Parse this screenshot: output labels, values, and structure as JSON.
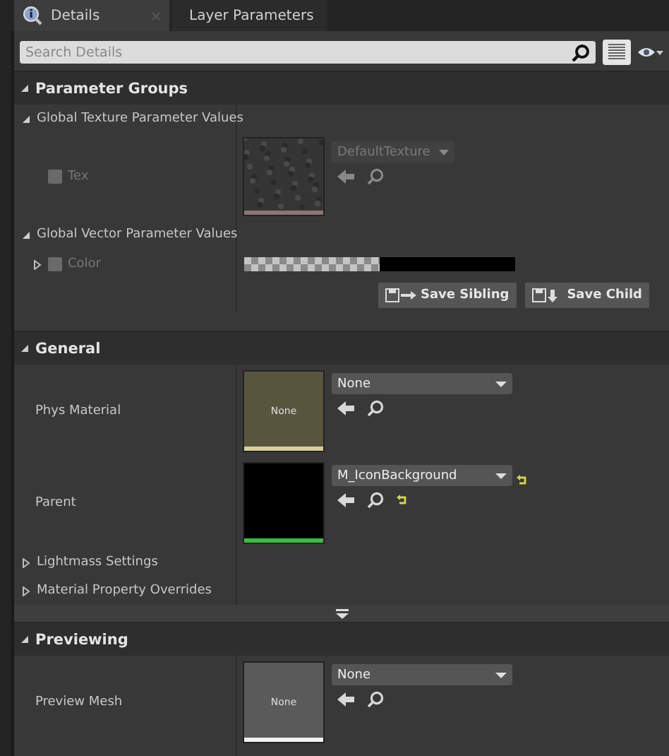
{
  "tabs": [
    {
      "label": "Details",
      "selected": true
    },
    {
      "label": "Layer Parameters",
      "selected": false
    }
  ],
  "search": {
    "placeholder": "Search Details"
  },
  "sections": [
    {
      "title": "Parameter Groups",
      "expanded": true,
      "rows": [
        {
          "kind": "group",
          "label": "Global Texture Parameter Values",
          "expanded": true
        },
        {
          "kind": "texture",
          "label": "Tex",
          "checked": false,
          "value": "DefaultTexture"
        },
        {
          "kind": "group",
          "label": "Global Vector Parameter Values",
          "expanded": true
        },
        {
          "kind": "color",
          "label": "Color",
          "checked": false,
          "expanded": false
        },
        {
          "kind": "actions",
          "buttons": [
            {
              "label": "Save Sibling",
              "kind": "sibling"
            },
            {
              "label": "Save Child",
              "kind": "child"
            }
          ]
        }
      ]
    },
    {
      "title": "General",
      "expanded": true,
      "rows": [
        {
          "kind": "physmat",
          "label": "Phys Material",
          "thumb_text": "None",
          "value": "None",
          "modified": false
        },
        {
          "kind": "material",
          "label": "Parent",
          "value": "M_IconBackground",
          "modified": true
        },
        {
          "kind": "group",
          "label": "Lightmass Settings",
          "expanded": false
        },
        {
          "kind": "group",
          "label": "Material Property Overrides",
          "expanded": false
        },
        {
          "kind": "advanced"
        }
      ]
    },
    {
      "title": "Previewing",
      "expanded": true,
      "rows": [
        {
          "kind": "mesh",
          "label": "Preview Mesh",
          "thumb_text": "None",
          "value": "None",
          "modified": false
        }
      ]
    }
  ]
}
